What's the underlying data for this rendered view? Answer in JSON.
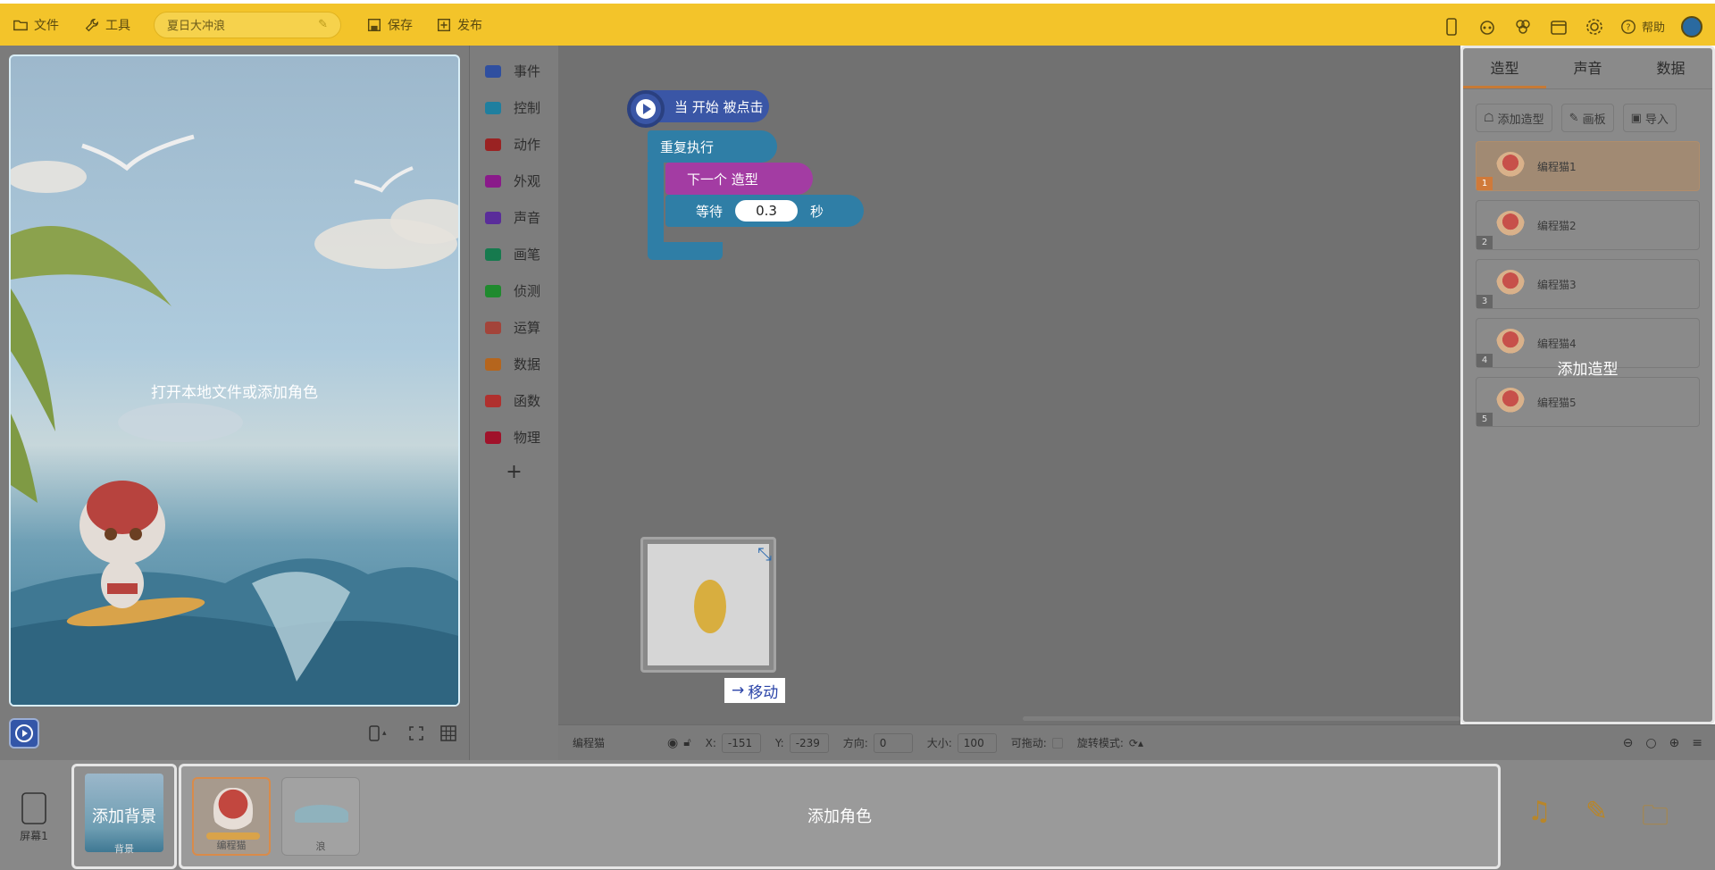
{
  "topbar": {
    "file_label": "文件",
    "tools_label": "工具",
    "project_name": "夏日大冲浪",
    "save_label": "保存",
    "publish_label": "发布",
    "help_label": "帮助"
  },
  "stage": {
    "overlay_text": "打开本地文件或添加角色"
  },
  "categories": [
    {
      "label": "事件",
      "color": "#2f4fa0"
    },
    {
      "label": "控制",
      "color": "#1f7f9f"
    },
    {
      "label": "动作",
      "color": "#9a2222"
    },
    {
      "label": "外观",
      "color": "#8a1a8a"
    },
    {
      "label": "声音",
      "color": "#5a2d9a"
    },
    {
      "label": "画笔",
      "color": "#167a4e"
    },
    {
      "label": "侦测",
      "color": "#1f8a2e"
    },
    {
      "label": "运算",
      "color": "#a3443a"
    },
    {
      "label": "数据",
      "color": "#b5651d"
    },
    {
      "label": "函数",
      "color": "#b0302e"
    },
    {
      "label": "物理",
      "color": "#a0122a"
    }
  ],
  "add_category": "+",
  "blocks": {
    "when_clicked": "当 开始 被点击",
    "repeat": "重复执行",
    "next_costume": "下一个 造型",
    "wait": "等待",
    "wait_value": "0.3",
    "wait_unit": "秒"
  },
  "drag_tooltip": "移动",
  "right_panel": {
    "tabs": [
      "造型",
      "声音",
      "数据"
    ],
    "add_costume": "添加造型",
    "paint": "画板",
    "import": "导入",
    "costumes": [
      {
        "name": "编程猫1",
        "num": "1"
      },
      {
        "name": "编程猫2",
        "num": "2"
      },
      {
        "name": "编程猫3",
        "num": "3"
      },
      {
        "name": "编程猫4",
        "num": "4"
      },
      {
        "name": "编程猫5",
        "num": "5"
      }
    ],
    "overlay_text": "添加造型"
  },
  "status": {
    "sprite_name": "编程猫",
    "x_label": "X:",
    "x_value": "-151",
    "y_label": "Y:",
    "y_value": "-239",
    "direction_label": "方向:",
    "direction_value": "0",
    "size_label": "大小:",
    "size_value": "100",
    "draggable_label": "可拖动:",
    "rotation_label": "旋转模式:"
  },
  "bottom": {
    "screen_label": "屏幕1",
    "background_label": "背景",
    "add_background": "添加背景",
    "add_sprite": "添加角色",
    "sprites": [
      {
        "name": "编程猫"
      },
      {
        "name": "浪"
      }
    ]
  },
  "colors": {
    "topbar": "#f3c42a",
    "accent": "#c77a36",
    "block_event": "#3a63c8",
    "block_control": "#2aa0c8",
    "block_looks": "#b33bb3"
  }
}
